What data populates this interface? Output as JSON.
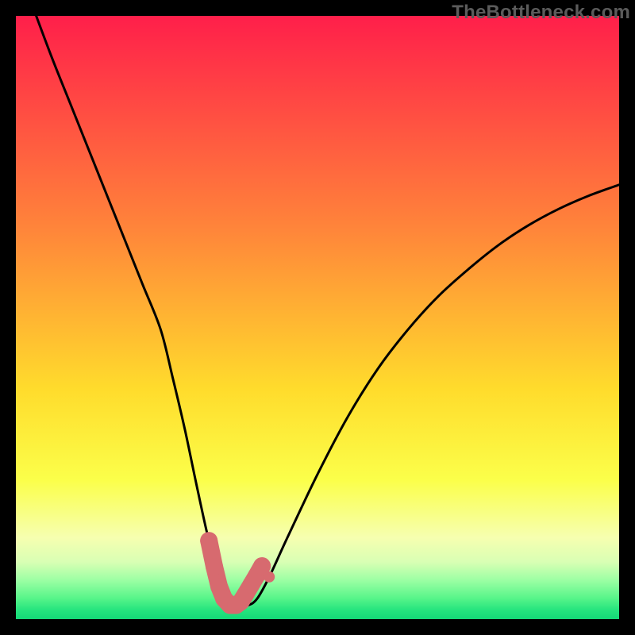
{
  "watermark": {
    "text": "TheBottleneck.com"
  },
  "colors": {
    "curve_stroke": "#000000",
    "marker_fill": "#d76a6f",
    "background_black": "#000000",
    "gradient_stops": [
      {
        "offset": 0.0,
        "color": "#ff1f4a"
      },
      {
        "offset": 0.35,
        "color": "#ff843a"
      },
      {
        "offset": 0.62,
        "color": "#ffdc2c"
      },
      {
        "offset": 0.77,
        "color": "#fbff4a"
      },
      {
        "offset": 0.865,
        "color": "#f6ffb0"
      },
      {
        "offset": 0.905,
        "color": "#d9ffb4"
      },
      {
        "offset": 0.935,
        "color": "#9dffa4"
      },
      {
        "offset": 0.965,
        "color": "#58f58a"
      },
      {
        "offset": 0.985,
        "color": "#25e47e"
      },
      {
        "offset": 1.0,
        "color": "#14d877"
      }
    ]
  },
  "chart_data": {
    "type": "line",
    "title": "",
    "xlabel": "",
    "ylabel": "",
    "xlim": [
      0,
      100
    ],
    "ylim": [
      0,
      100
    ],
    "grid": false,
    "x_samples": [
      3,
      6,
      9,
      12,
      15,
      18,
      21,
      24,
      26,
      28,
      30,
      32,
      33.8,
      35.5,
      37,
      38.5,
      40,
      42,
      45,
      50,
      55,
      60,
      65,
      70,
      75,
      80,
      85,
      90,
      95,
      100
    ],
    "series": [
      {
        "name": "bottleneck-curve",
        "values": [
          101,
          93,
          85.5,
          78,
          70.5,
          63,
          55.5,
          48,
          40,
          31.5,
          22,
          13,
          7,
          3.4,
          2.3,
          2.3,
          3.4,
          7,
          13.5,
          24,
          33.5,
          41.5,
          48,
          53.5,
          58,
          62,
          65.3,
          68,
          70.2,
          72
        ]
      }
    ],
    "annotations": [
      {
        "name": "watermark",
        "text": "TheBottleneck.com",
        "pos": "top-right"
      }
    ],
    "markers": {
      "name": "highlighted-range",
      "color": "#d76a6f",
      "x": [
        32,
        32.9,
        33.7,
        34.5,
        35.5,
        36.5,
        37.3,
        38.1,
        39,
        39.9,
        40.8,
        42
      ],
      "y": [
        13,
        8.7,
        5.4,
        3.4,
        2.3,
        2.3,
        2.9,
        4.2,
        5.7,
        7.2,
        8.8,
        7
      ]
    }
  }
}
